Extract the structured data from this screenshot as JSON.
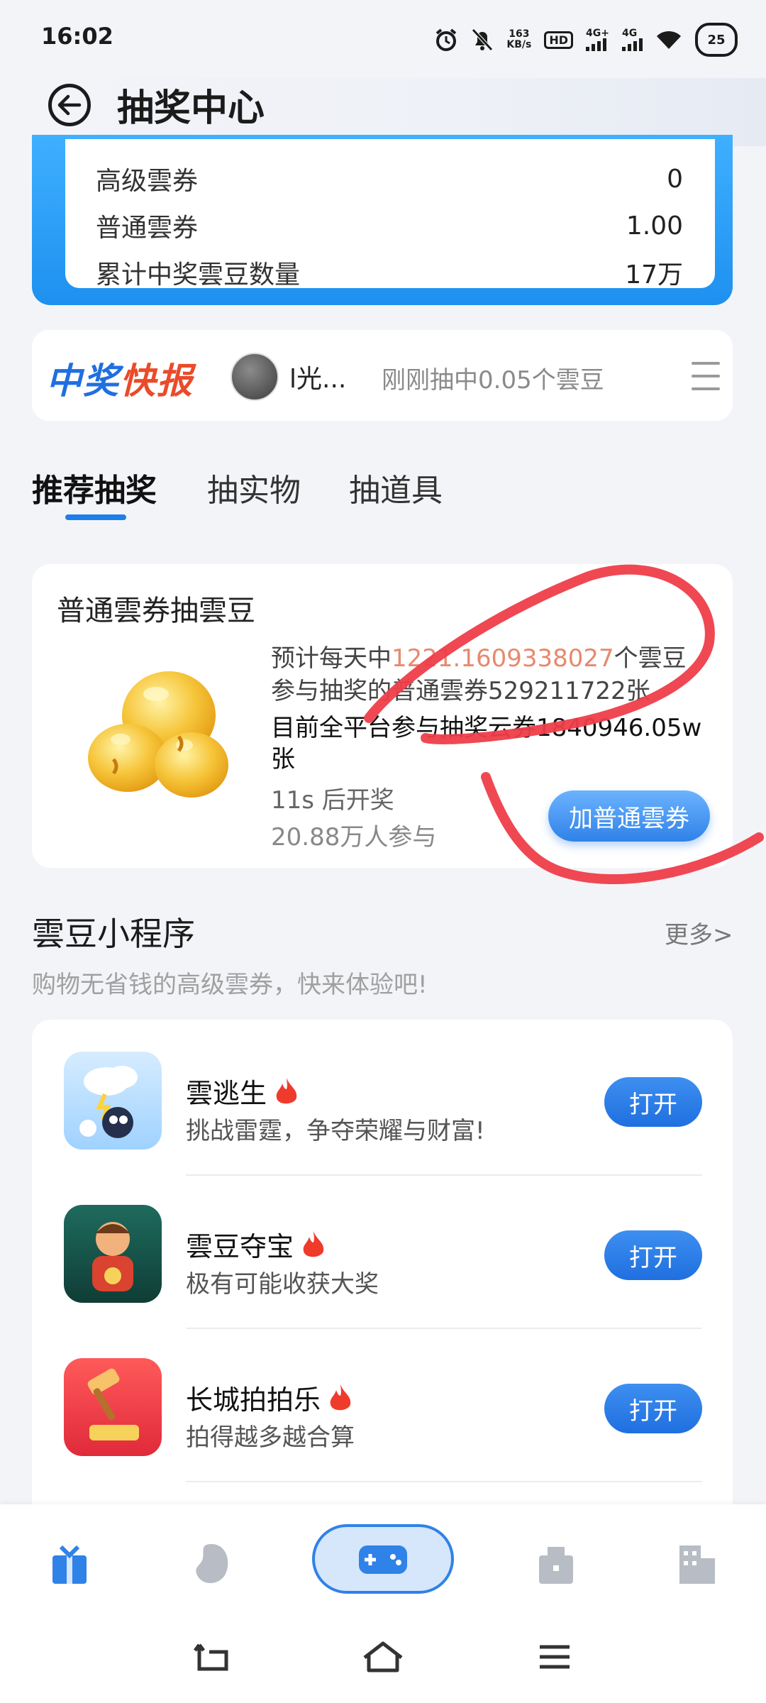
{
  "status_bar": {
    "time": "16:02",
    "net_speed_value": "163",
    "net_speed_unit": "KB/s",
    "hd_label": "HD",
    "sim1_label": "4G+",
    "sim2_label": "4G",
    "battery": "25"
  },
  "header": {
    "title": "抽奖中心",
    "back_icon": "back-arrow-icon"
  },
  "stats": [
    {
      "label": "高级雲券",
      "value": "0"
    },
    {
      "label": "普通雲券",
      "value": "1.00"
    },
    {
      "label": "累计中奖雲豆数量",
      "value": "17万"
    }
  ],
  "news": {
    "brand_part1": "中奖",
    "brand_part2": "快报",
    "user": "l光...",
    "message": "刚刚抽中0.05个雲豆"
  },
  "tabs": [
    {
      "label": "推荐抽奖",
      "active": true
    },
    {
      "label": "抽实物",
      "active": false
    },
    {
      "label": "抽道具",
      "active": false
    }
  ],
  "lottery": {
    "title": "普通雲券抽雲豆",
    "line1_prefix": "预计每天中",
    "line1_number": "1221.1609338027",
    "line1_suffix": "个雲豆",
    "line2": "参与抽奖的普通雲券529211722张",
    "line3": "目前全平台参与抽奖云券1840946.05w",
    "line4": "张",
    "countdown": "11s 后开奖",
    "participants": "20.88万人参与",
    "button": "加普通雲券"
  },
  "mini_programs": {
    "title": "雲豆小程序",
    "more": "更多>",
    "subtitle": "购物无省钱的高级雲券，快来体验吧!",
    "items": [
      {
        "name": "雲逃生",
        "desc": "挑战雷霆，争夺荣耀与财富!",
        "button": "打开"
      },
      {
        "name": "雲豆夺宝",
        "desc": "极有可能收获大奖",
        "button": "打开"
      },
      {
        "name": "长城拍拍乐",
        "desc": "拍得越多越合算",
        "button": "打开"
      }
    ]
  },
  "bottom_nav": {
    "items": [
      "gift-icon",
      "bean-icon",
      "gamepad-icon",
      "building-icon",
      "tower-icon"
    ],
    "active": "gift-icon"
  },
  "colors": {
    "accent": "#1f7fe8",
    "highlight_number": "#e7896d",
    "annotation_red": "#ee3e4a"
  }
}
